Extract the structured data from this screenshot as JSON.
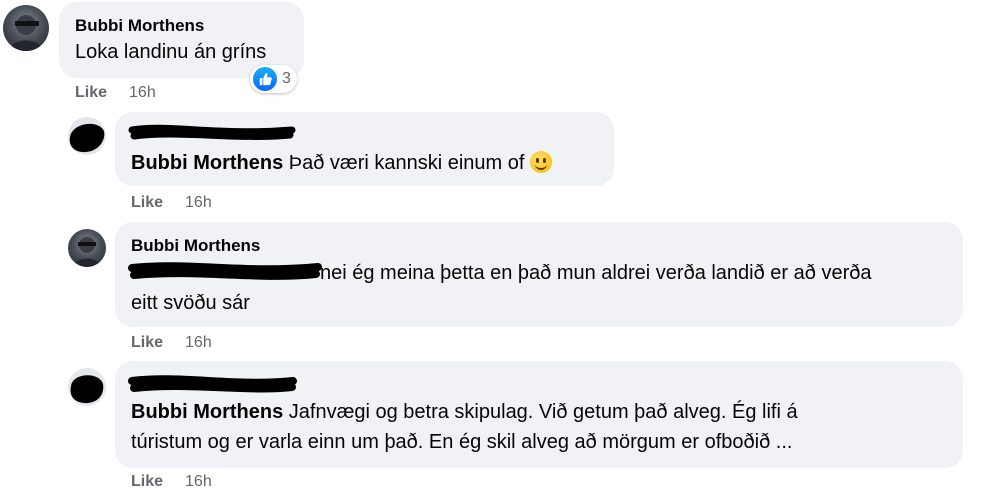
{
  "comments": [
    {
      "author": "Bubbi Morthens",
      "text": "Loka landinu án gríns",
      "like_label": "Like",
      "time": "16h",
      "reaction_count": "3"
    },
    {
      "mention": "Bubbi Morthens",
      "text": " Það væri kannski einum of ",
      "like_label": "Like",
      "time": "16h"
    },
    {
      "author": "Bubbi Morthens",
      "line1": " nei ég meina þetta en það mun aldrei verða landið er að verða",
      "line2": "eitt svöðu sár",
      "like_label": "Like",
      "time": "16h"
    },
    {
      "mention": "Bubbi Morthens",
      "line1": " Jafnvægi og betra skipulag. Við getum það alveg. Ég lifi á",
      "line2": "túristum og er varla einn um það. En ég skil alveg að mörgum er ofboðið ...",
      "like_label": "Like",
      "time": "16h"
    }
  ],
  "icons": [
    "like-thumb-icon",
    "smiley-emoji-icon"
  ],
  "colors": {
    "bubble": "#f0f2f5",
    "meta": "#65676b",
    "like_blue": "#0866ff"
  }
}
